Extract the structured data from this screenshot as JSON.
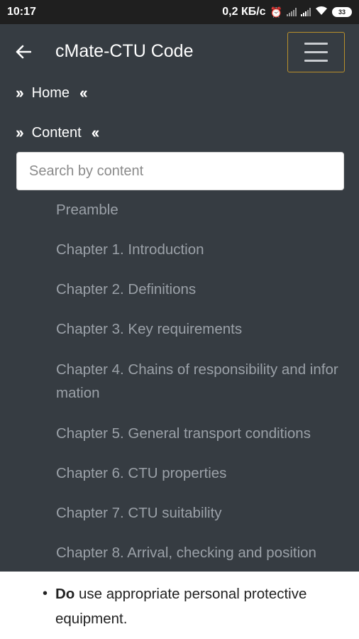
{
  "status_bar": {
    "time": "10:17",
    "net_speed": "0,2 КБ/с",
    "battery": "33"
  },
  "header": {
    "title": "cMate-CTU Code"
  },
  "nav": {
    "home": "Home",
    "content": "Content"
  },
  "search": {
    "placeholder": "Search by content"
  },
  "toc": [
    "Preamble",
    "Chapter 1. Introduction",
    "Chapter 2. Definitions",
    "Chapter 3. Key requirements",
    "Chapter 4. Chains of responsibility and information",
    "Chapter 5. General transport conditions",
    "Chapter 6. CTU properties",
    "Chapter 7. CTU suitability",
    "Chapter 8. Arrival, checking and position"
  ],
  "page_content": {
    "bullet_bold": "Do",
    "bullet_text": " use appropriate personal protective equipment."
  },
  "colors": {
    "drawer_bg": "#363c42",
    "menu_border": "#b9902c",
    "toc_text": "#9ba1a8"
  }
}
